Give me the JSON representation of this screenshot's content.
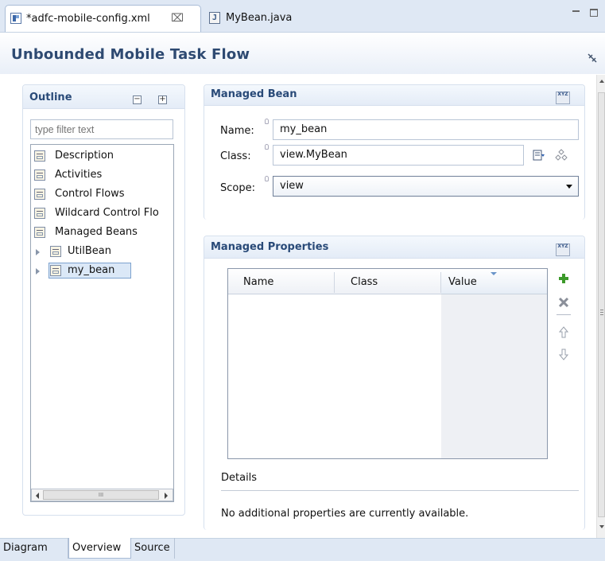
{
  "editor_tabs": [
    {
      "label": "*adfc-mobile-config.xml",
      "active": true,
      "close_symbol": "⌧"
    },
    {
      "label": "MyBean.java",
      "active": false
    }
  ],
  "header": {
    "title": "Unbounded Mobile Task Flow"
  },
  "outline": {
    "title": "Outline",
    "filter_placeholder": "type filter text",
    "items": [
      {
        "label": "Description"
      },
      {
        "label": "Activities"
      },
      {
        "label": "Control Flows"
      },
      {
        "label": "Wildcard Control Flo"
      },
      {
        "label": "Managed Beans"
      },
      {
        "label": "UtilBean"
      },
      {
        "label": "my_bean"
      }
    ],
    "hscroll_thumb": "III"
  },
  "managed_bean": {
    "title": "Managed Bean",
    "name_label": "Name:",
    "name_value": "my_bean",
    "class_label": "Class:",
    "class_value": "view.MyBean",
    "scope_label": "Scope:",
    "scope_value": "view"
  },
  "managed_properties": {
    "title": "Managed Properties",
    "columns": [
      "Name",
      "Class",
      "Value"
    ],
    "details_label": "Details",
    "details_text": "No additional properties are currently available."
  },
  "bottom_tabs": [
    {
      "label": "Diagram",
      "active": false
    },
    {
      "label": "Overview",
      "active": true
    },
    {
      "label": "Source",
      "active": false
    }
  ],
  "colors": {
    "accent": "#294a78",
    "tab_bar": "#dfe8f4",
    "add_green": "#3c9a2a"
  }
}
